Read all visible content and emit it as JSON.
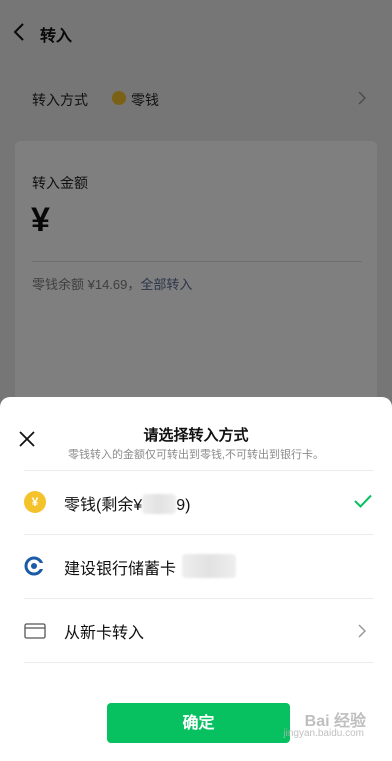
{
  "header": {
    "title": "转入"
  },
  "method_row": {
    "label": "转入方式",
    "value": "零钱"
  },
  "amount_card": {
    "label": "转入金额",
    "currency_symbol": "¥",
    "balance_prefix": "零钱余额 ¥14.69，",
    "balance_link": "全部转入"
  },
  "sheet": {
    "title": "请选择转入方式",
    "subtitle": "零钱转入的金额仅可转出到零钱,不可转出到银行卡。",
    "options": [
      {
        "label": "零钱(剩余¥",
        "label_tail": "9)",
        "icon": "coin-icon",
        "selected": true,
        "coin_glyph": "¥"
      },
      {
        "label": "建设银行储蓄卡",
        "icon": "ccb-bank-icon",
        "selected": false
      },
      {
        "label": "从新卡转入",
        "icon": "card-icon",
        "selected": false
      }
    ],
    "confirm_label": "确定"
  },
  "watermark": {
    "text": "Bai 经验",
    "url": "jingyan.baidu.com"
  },
  "colors": {
    "accent_green": "#07c160",
    "link_blue": "#576b95",
    "coin_yellow": "#f4c22b"
  }
}
